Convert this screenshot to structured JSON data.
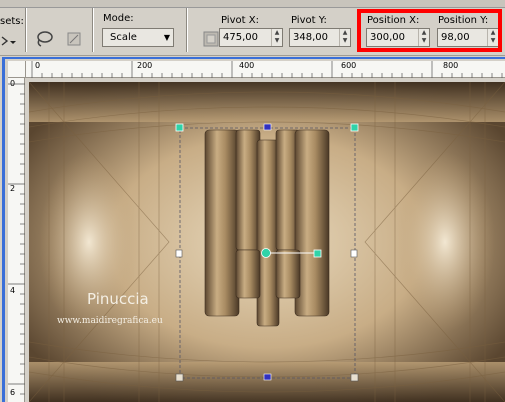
{
  "toolbar": {
    "presets_label": "sets:",
    "mode_label": "Mode:",
    "mode_value": "Scale",
    "pivot_x_label": "Pivot X:",
    "pivot_x_value": "475,00",
    "pivot_y_label": "Pivot Y:",
    "pivot_y_value": "348,00",
    "position_x_label": "Position X:",
    "position_x_value": "300,00",
    "position_y_label": "Position Y:",
    "position_y_value": "98,00",
    "highlight_color": "#ff0000"
  },
  "ruler": {
    "h_labels": [
      "0",
      "200",
      "400",
      "600",
      "800"
    ],
    "v_labels": [
      "0",
      "2",
      "4",
      "6"
    ]
  },
  "watermark": {
    "name": "Pinuccia",
    "site": "www.maidiregrafica.eu"
  },
  "colors": {
    "window_border": "#3a6fd8",
    "handle": "#2fd3a8",
    "handle_blue": "#3030c0"
  }
}
